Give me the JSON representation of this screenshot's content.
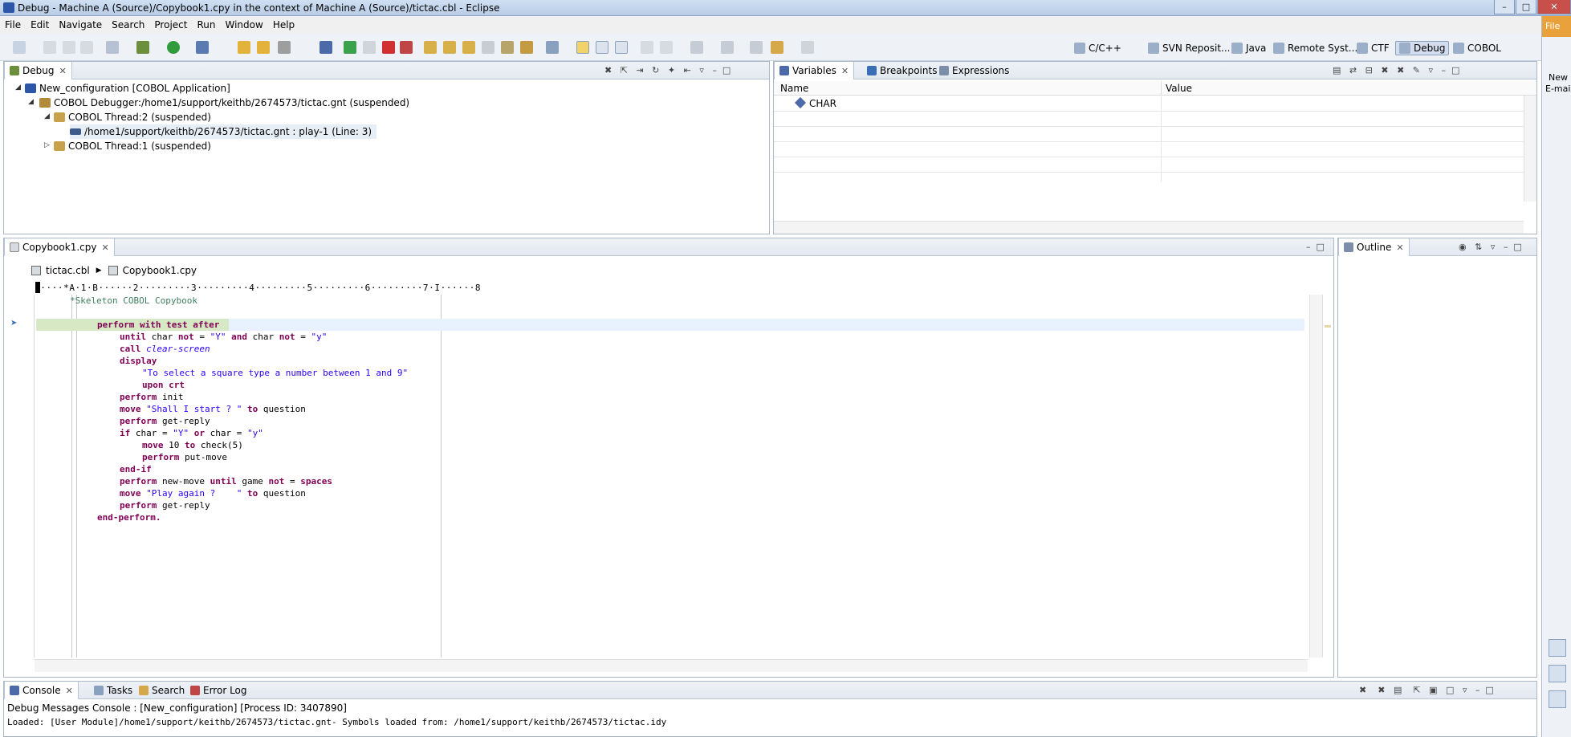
{
  "window": {
    "title": "Debug - Machine A (Source)/Copybook1.cpy in the context of Machine A (Source)/tictac.cbl - Eclipse"
  },
  "menu": [
    "File",
    "Edit",
    "Navigate",
    "Search",
    "Project",
    "Run",
    "Window",
    "Help"
  ],
  "perspectives": [
    {
      "label": "C/C++",
      "active": false
    },
    {
      "label": "SVN Reposit...",
      "active": false
    },
    {
      "label": "Java",
      "active": false
    },
    {
      "label": "Remote Syst...",
      "active": false
    },
    {
      "label": "CTF",
      "active": false
    },
    {
      "label": "Debug",
      "active": true
    },
    {
      "label": "COBOL",
      "active": false
    }
  ],
  "debug_view": {
    "tab_label": "Debug",
    "tree": [
      {
        "label": "New_configuration [COBOL Application]"
      },
      {
        "label": "COBOL Debugger:/home1/support/keithb/2674573/tictac.gnt (suspended)"
      },
      {
        "label": "COBOL Thread:2 (suspended)"
      },
      {
        "label": "/home1/support/keithb/2674573/tictac.gnt : play-1 (Line: 3)"
      },
      {
        "label": "COBOL Thread:1 (suspended)"
      }
    ]
  },
  "variables_view": {
    "tabs": [
      "Variables",
      "Breakpoints",
      "Expressions"
    ],
    "columns": [
      "Name",
      "Value"
    ],
    "rows": [
      {
        "name": "CHAR",
        "value": ""
      }
    ]
  },
  "editor": {
    "tab_label": "Copybook1.cpy",
    "breadcrumb": [
      "tictac.cbl",
      "Copybook1.cpy"
    ],
    "ruler": "·····*A·1·B······2·········3·········4·········5·········6·········7·I······8",
    "lines": [
      "*Skeleton COBOL Copybook",
      "",
      "perform with test after",
      "until char not = \"Y\" and char not = \"y\"",
      "call clear-screen",
      "display",
      "\"To select a square type a number between 1 and 9\"",
      "upon crt",
      "perform init",
      "move \"Shall I start ? \" to question",
      "perform get-reply",
      "if char = \"Y\" or char = \"y\"",
      "move 10 to check(5)",
      "perform put-move",
      "end-if",
      "perform new-move until game not = spaces",
      "move \"Play again ?    \" to question",
      "perform get-reply",
      "end-perform."
    ]
  },
  "outline_view": {
    "tab_label": "Outline"
  },
  "bottom_tabs": [
    "Console",
    "Tasks",
    "Search",
    "Error Log"
  ],
  "console": {
    "header": "Debug Messages Console : [New_configuration] [Process ID: 3407890]",
    "text": "Loaded: [User Module]/home1/support/keithb/2674573/tictac.gnt- Symbols loaded from: /home1/support/keithb/2674573/tictac.idy"
  },
  "right_strip": {
    "file_label": "File",
    "new_label": "New",
    "email_label": "E-mai"
  },
  "colors": {
    "accent": "#2e56a8",
    "highlight": "#d6e8c4",
    "keyword": "#7f0055",
    "string": "#2a00ff",
    "comment": "#3f7f5f"
  }
}
